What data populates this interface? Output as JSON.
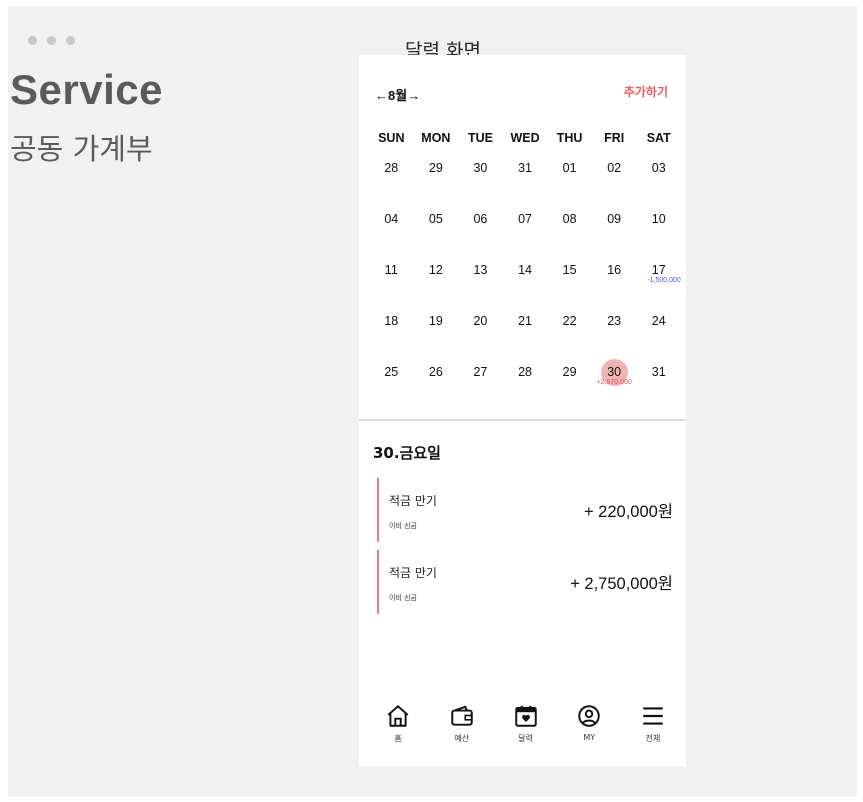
{
  "header": {
    "title": "Service",
    "subtitle": "공동 가계부"
  },
  "screen_label": "달력 화면",
  "calendar": {
    "month_nav": "←8월→",
    "add_label": "추가하기",
    "weekdays": [
      "SUN",
      "MON",
      "TUE",
      "WED",
      "THU",
      "FRI",
      "SAT"
    ],
    "weeks": [
      [
        "28",
        "29",
        "30",
        "31",
        "01",
        "02",
        "03"
      ],
      [
        "04",
        "05",
        "06",
        "07",
        "08",
        "09",
        "10"
      ],
      [
        "11",
        "12",
        "13",
        "14",
        "15",
        "16",
        "17"
      ],
      [
        "18",
        "19",
        "20",
        "21",
        "22",
        "23",
        "24"
      ],
      [
        "25",
        "26",
        "27",
        "28",
        "29",
        "30",
        "31"
      ]
    ],
    "amount_17": "-1,500,000",
    "amount_30": "+2,970,000",
    "selected_day": "30",
    "colors": {
      "selected": "#f4b3b3",
      "expense": "#4a5cf2",
      "income": "#e25757",
      "accent": "#ef5b5b"
    }
  },
  "day_detail": {
    "heading": "30.금요일",
    "entries": [
      {
        "title": "적금 만기",
        "sub": "이비 신금",
        "amount": "+ 220,000원"
      },
      {
        "title": "적금 만기",
        "sub": "이비 신금",
        "amount": "+ 2,750,000원"
      }
    ]
  },
  "tabbar": {
    "items": [
      {
        "label": "홈",
        "icon": "home-icon"
      },
      {
        "label": "예산",
        "icon": "wallet-icon"
      },
      {
        "label": "달력",
        "icon": "calendar-icon"
      },
      {
        "label": "MY",
        "icon": "profile-icon"
      },
      {
        "label": "전체",
        "icon": "menu-icon"
      }
    ]
  }
}
